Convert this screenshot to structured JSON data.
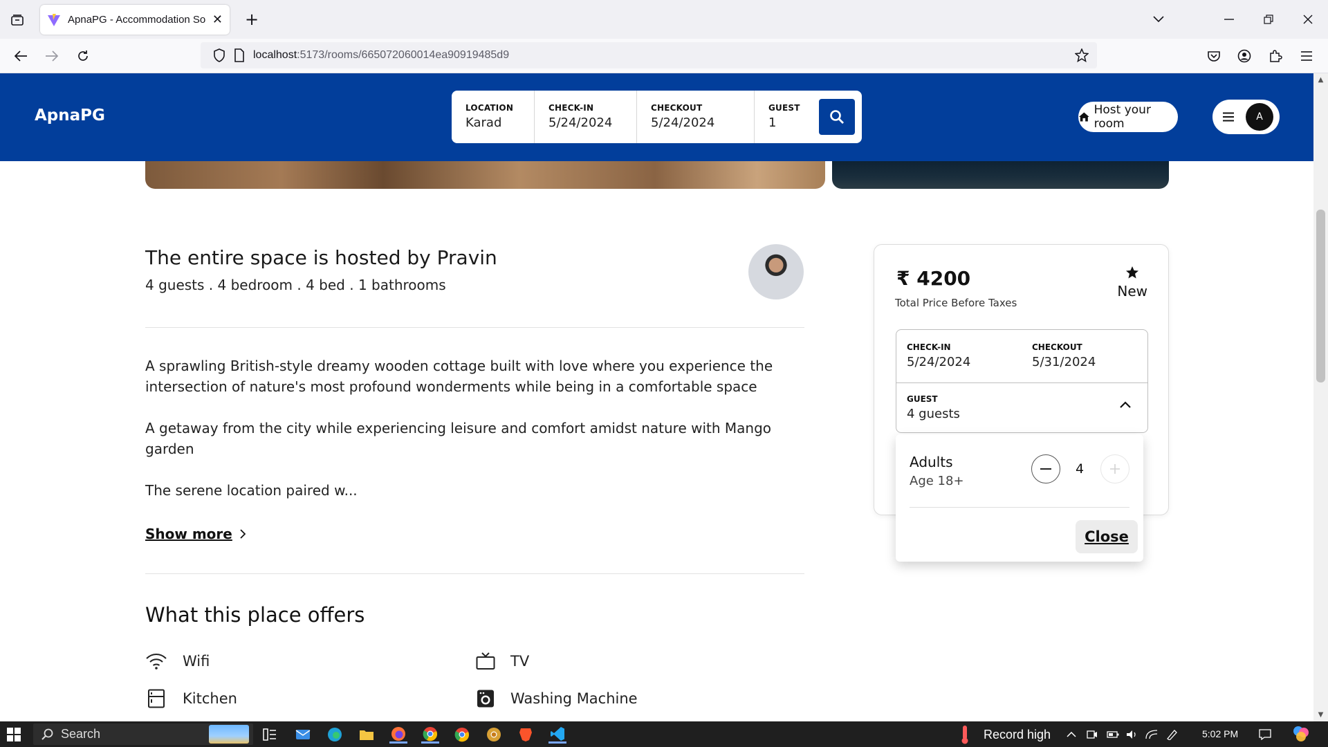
{
  "browser": {
    "tab_title": "ApnaPG - Accommodation Solu",
    "url_host": "localhost",
    "url_rest": ":5173/rooms/665072060014ea90919485d9"
  },
  "header": {
    "logo": "ApnaPG",
    "search": {
      "location_label": "LOCATION",
      "location_value": "Karad",
      "checkin_label": "CHECK-IN",
      "checkin_value": "5/24/2024",
      "checkout_label": "CHECKOUT",
      "checkout_value": "5/24/2024",
      "guest_label": "GUEST",
      "guest_value": "1"
    },
    "host_button": "Host your room",
    "avatar_initial": "A"
  },
  "listing": {
    "host_title": "The entire space is hosted by Pravin",
    "host_sub": "4 guests . 4 bedroom . 4 bed . 1 bathrooms",
    "description": [
      "A sprawling British-style dreamy wooden cottage built with love where you experience the intersection of nature's most profound wonderments while being in a comfortable space",
      "A getaway from the city while experiencing leisure and comfort amidst nature with Mango garden",
      "The serene location paired w..."
    ],
    "show_more": "Show more",
    "offers_title": "What this place offers",
    "offers": [
      {
        "label": "Wifi",
        "icon": "wifi-icon"
      },
      {
        "label": "TV",
        "icon": "tv-icon"
      },
      {
        "label": "Kitchen",
        "icon": "kitchen-icon"
      },
      {
        "label": "Washing Machine",
        "icon": "washing-machine-icon"
      }
    ]
  },
  "booking": {
    "currency": "₹",
    "price": "4200",
    "price_sub": "Total Price Before Taxes",
    "rating": "New",
    "checkin_label": "CHECK-IN",
    "checkin_value": "5/24/2024",
    "checkout_label": "CHECKOUT",
    "checkout_value": "5/31/2024",
    "guest_label": "GUEST",
    "guest_value": "4 guests",
    "popup": {
      "adults_label": "Adults",
      "adults_sub": "Age 18+",
      "adults_count": "4",
      "close_label": "Close"
    }
  },
  "taskbar": {
    "search_placeholder": "Search",
    "weather": "Record high",
    "time": "5:02 PM"
  },
  "colors": {
    "brand": "#023e9b",
    "taskbar": "#1f1f1f"
  }
}
